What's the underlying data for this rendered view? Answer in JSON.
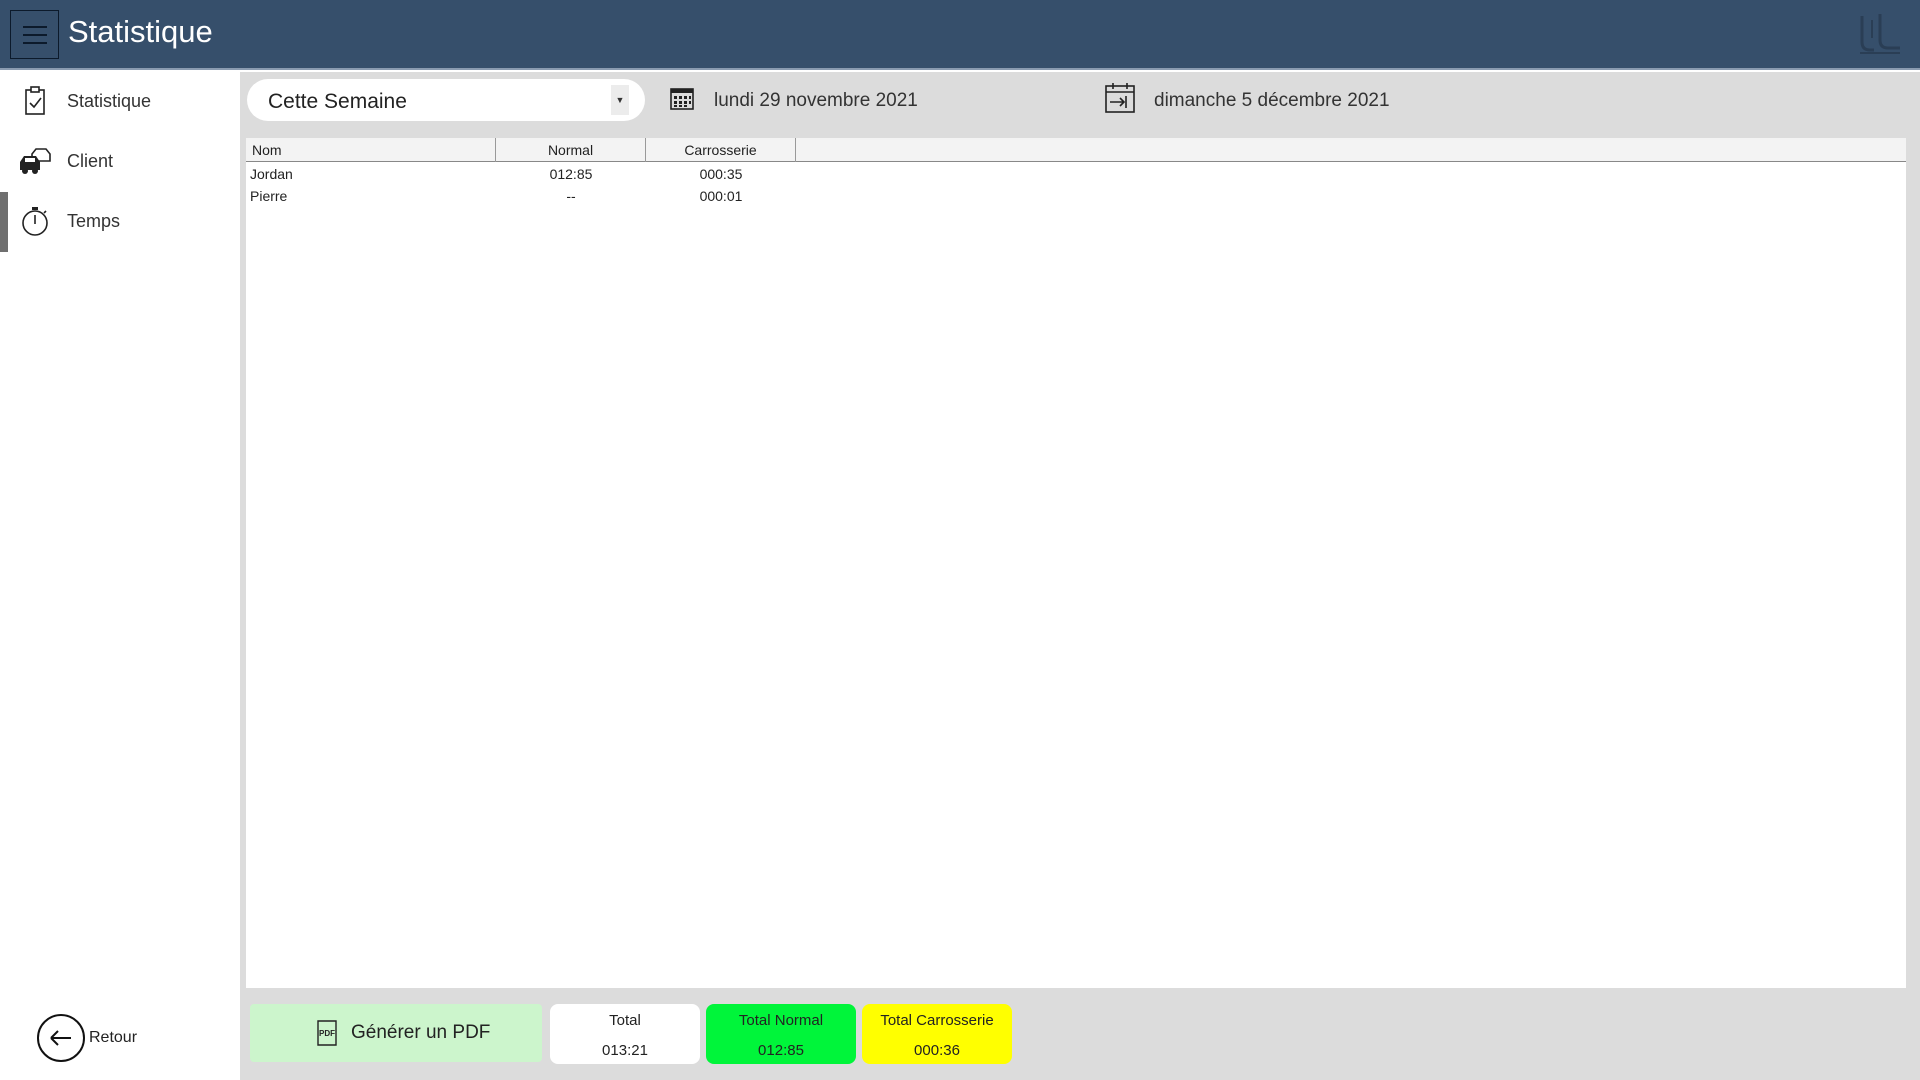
{
  "app": {
    "title": "Statistique"
  },
  "sidebar": {
    "items": [
      {
        "label": "Statistique",
        "icon": "clipboard-check-icon"
      },
      {
        "label": "Client",
        "icon": "cars-icon"
      },
      {
        "label": "Temps",
        "icon": "stopwatch-icon"
      }
    ],
    "active_index": 2,
    "back_label": "Retour"
  },
  "filters": {
    "period_selected": "Cette Semaine",
    "start_date": "lundi 29 novembre 2021",
    "end_date": "dimanche 5 décembre 2021"
  },
  "table": {
    "columns": [
      "Nom",
      "Normal",
      "Carrosserie"
    ],
    "rows": [
      [
        "Jordan",
        "012:85",
        "000:35"
      ],
      [
        "Pierre",
        "--",
        "000:01"
      ]
    ]
  },
  "footer": {
    "pdf_label": "Générer un PDF",
    "pdf_icon_text": "PDF",
    "totals": [
      {
        "label": "Total",
        "value": "013:21",
        "color": "#ffffff"
      },
      {
        "label": "Total Normal",
        "value": "012:85",
        "color": "#00f53a"
      },
      {
        "label": "Total Carrosserie",
        "value": "000:36",
        "color": "#ffff00"
      }
    ]
  },
  "colors": {
    "titlebar": "#364f6b",
    "content_bg": "#dcdcdc",
    "pdf_button": "#ccf5cc"
  }
}
